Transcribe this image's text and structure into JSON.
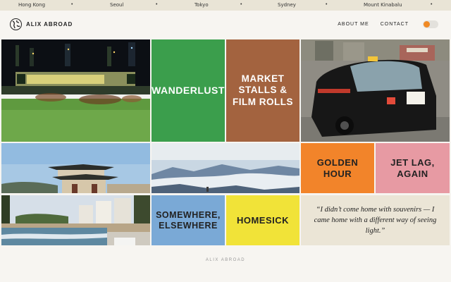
{
  "ticker": {
    "cities": [
      "Hong Kong",
      "Seoul",
      "Tokyo",
      "Sydney",
      "Mount Kinabalu"
    ],
    "separator": "•"
  },
  "header": {
    "brand": "ALIX ABROAD",
    "logo_icon": "globe-icon",
    "nav": [
      "ABOUT ME",
      "CONTACT"
    ],
    "toggle_on": true
  },
  "tiles": {
    "wanderlust": "WANDERLUST",
    "market": [
      "MARKET",
      "STALLS &",
      "FILM ROLLS"
    ],
    "golden": [
      "GOLDEN",
      "HOUR"
    ],
    "jetlag": [
      "JET LAG,",
      "AGAIN"
    ],
    "somewhere": [
      "SOMEWHERE,",
      "ELSEWHERE"
    ],
    "homesick": "HOMESICK",
    "quote": "“I didn’t come home with souvenirs — I came home with a different way of seeing light.”"
  },
  "colors": {
    "green": "#3b9e4c",
    "brown": "#a3633f",
    "orange": "#f2842a",
    "pink": "#e79aa3",
    "blue": "#7aa9d6",
    "yellow": "#f1e338",
    "cream": "#ebe5d6",
    "toggle_accent": "#f08a24"
  },
  "footer": "ALIX ABROAD"
}
